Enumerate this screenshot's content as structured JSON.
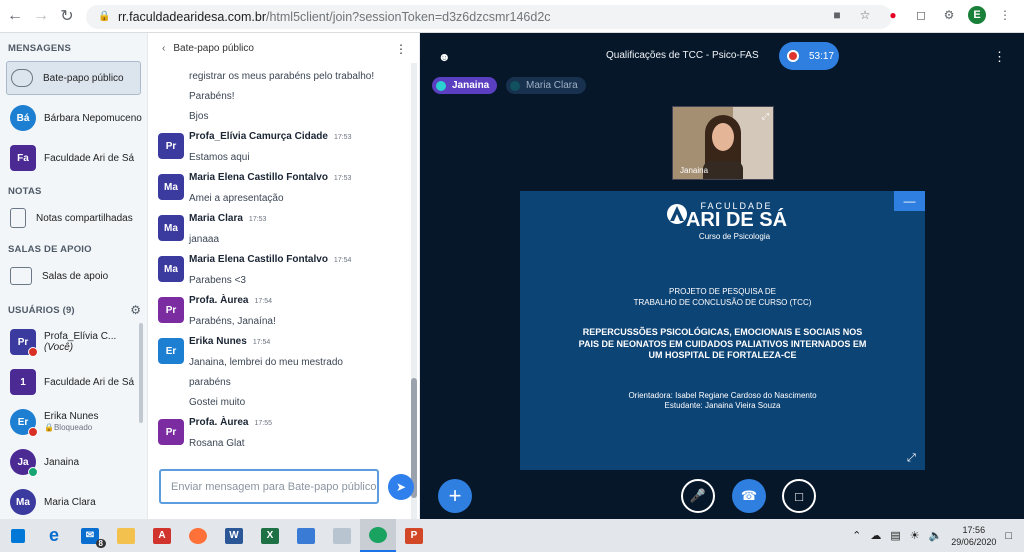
{
  "browser": {
    "url_host": "rr.faculdadearidesa.com.br",
    "url_path": "/html5client/join?sessionToken=d3z6dzcsmr146d2c",
    "profile_initial": "E"
  },
  "userlist": {
    "messages_title": "MENSAGENS",
    "public_chat": "Bate-papo público",
    "private_chats": [
      {
        "initials": "Bá",
        "name": "Bárbara Nepomuceno",
        "color": "#1d7fd1"
      },
      {
        "initials": "Fa",
        "name": "Faculdade Ari de Sá",
        "color": "#4b2a94"
      }
    ],
    "notes_title": "NOTAS",
    "notes_item": "Notas compartilhadas",
    "rooms_title": "SALAS DE APOIO",
    "rooms_item": "Salas de apoio",
    "users_title": "USUÁRIOS (9)",
    "users": [
      {
        "initials": "Pr",
        "name": "Profa_Elívia C...",
        "suffix": "(Você)",
        "sub": "",
        "color": "#3b3a9e"
      },
      {
        "initials": "1",
        "name": "Faculdade Ari de Sá",
        "suffix": "",
        "sub": "",
        "color": "#4b2a94"
      },
      {
        "initials": "Er",
        "name": "Erika Nunes",
        "suffix": "",
        "sub": "Bloqueado",
        "color": "#1d7fd1"
      },
      {
        "initials": "Ja",
        "name": "Janaina",
        "suffix": "",
        "sub": "",
        "color": "#4b2a94"
      },
      {
        "initials": "Ma",
        "name": "Maria Clara",
        "suffix": "",
        "sub": "",
        "color": "#3b3a9e"
      }
    ]
  },
  "chat": {
    "header": "Bate-papo público",
    "input_placeholder": "Enviar mensagem para Bate-papo público",
    "top_lines": [
      "registrar os meus parabéns pelo trabalho!",
      "Parabéns!",
      "Bjos"
    ],
    "messages": [
      {
        "initials": "Pr",
        "name": "Profa_Elívia Camurça Cidade",
        "time": "17:53",
        "lines": [
          "Estamos aqui"
        ],
        "color": "#3b3a9e"
      },
      {
        "initials": "Ma",
        "name": "Maria Elena Castillo Fontalvo",
        "time": "17:53",
        "lines": [
          "Amei a apresentação"
        ],
        "color": "#3b3a9e"
      },
      {
        "initials": "Ma",
        "name": "Maria Clara",
        "time": "17:53",
        "lines": [
          "janaaa"
        ],
        "color": "#3b3a9e"
      },
      {
        "initials": "Ma",
        "name": "Maria Elena Castillo Fontalvo",
        "time": "17:54",
        "lines": [
          "Parabens <3"
        ],
        "color": "#3b3a9e"
      },
      {
        "initials": "Pr",
        "name": "Profa. Àurea",
        "time": "17:54",
        "lines": [
          "Parabéns, Janaína!"
        ],
        "color": "#7a2ca0"
      },
      {
        "initials": "Er",
        "name": "Erika Nunes",
        "time": "17:54",
        "lines": [
          "Janaina, lembrei do meu mestrado",
          "parabéns",
          "Gostei muito"
        ],
        "color": "#1d7fd1"
      },
      {
        "initials": "Pr",
        "name": "Profa. Àurea",
        "time": "17:55",
        "lines": [
          "Rosana Glat"
        ],
        "color": "#7a2ca0"
      }
    ]
  },
  "main": {
    "meeting_title": "Qualificações de TCC - Psico-FAS",
    "timer": "53:17",
    "talkers": [
      {
        "name": "Janaina",
        "bg": "#5a3fc0",
        "dot": "#2bd0d0"
      },
      {
        "name": "Maria Clara",
        "bg": "#17314f",
        "dot": "#11505e"
      }
    ],
    "webcam_label": "Janaina",
    "slide": {
      "brand_top": "FACULDADE",
      "brand": "ARI DE SÁ",
      "subtitle": "Curso de Psicologia",
      "line1": "PROJETO DE PESQUISA DE",
      "line2": "TRABALHO DE CONCLUSÃO DE CURSO (TCC)",
      "title1": "REPERCUSSÕES PSICOLÓGICAS, EMOCIONAIS E SOCIAIS NOS",
      "title2": "PAIS DE NEONATOS EM CUIDADOS PALIATIVOS INTERNADOS EM",
      "title3": "UM HOSPITAL DE FORTALEZA-CE",
      "advisor": "Orientadora: Isabel Regiane Cardoso do Nascimento",
      "student": "Estudante: Janaina Vieira Souza"
    }
  },
  "taskbar": {
    "mail_badge": "8",
    "time": "17:56",
    "date": "29/06/2020"
  }
}
